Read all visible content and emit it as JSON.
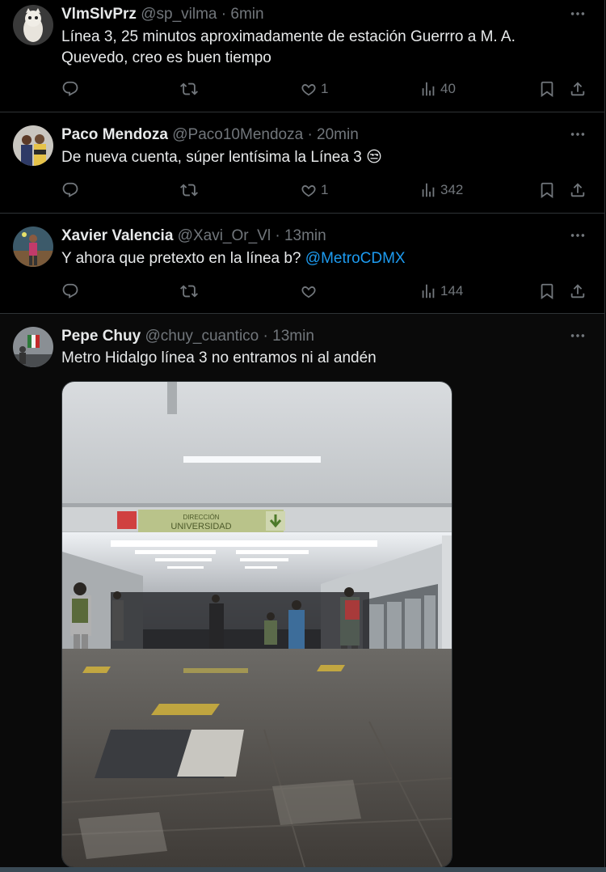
{
  "tweets": [
    {
      "name": "VlmSlvPrz",
      "handle": "@sp_vilma",
      "time": "· 6min",
      "text": "Línea 3, 25 minutos aproximadamente de estación Guerrro a M. A. Quevedo, creo es buen tiempo",
      "retweets": "",
      "likes": "1",
      "views": "40"
    },
    {
      "name": "Paco Mendoza",
      "handle": "@Paco10Mendoza",
      "time": "· 20min",
      "text": "De nueva cuenta, súper lentísima la Línea 3",
      "emoji": "😒",
      "retweets": "",
      "likes": "1",
      "views": "342"
    },
    {
      "name": "Xavier Valencia",
      "handle": "@Xavi_Or_Vl",
      "time": "· 13min",
      "text": "Y ahora que pretexto en la línea b?",
      "mention": "@MetroCDMX",
      "retweets": "",
      "likes": "",
      "views": "144"
    },
    {
      "name": "Pepe Chuy",
      "handle": "@chuy_cuantico",
      "time": "· 13min",
      "text": "Metro Hidalgo línea 3 no entramos ni al andén"
    }
  ],
  "photo": {
    "sign_line1": "DIRECCIÓN",
    "sign_line2": "UNIVERSIDAD"
  },
  "colors": {
    "background": "#000000",
    "text": "#e7e9ea",
    "muted": "#71767b",
    "link": "#1d9bf0",
    "divider": "#2f3336"
  }
}
